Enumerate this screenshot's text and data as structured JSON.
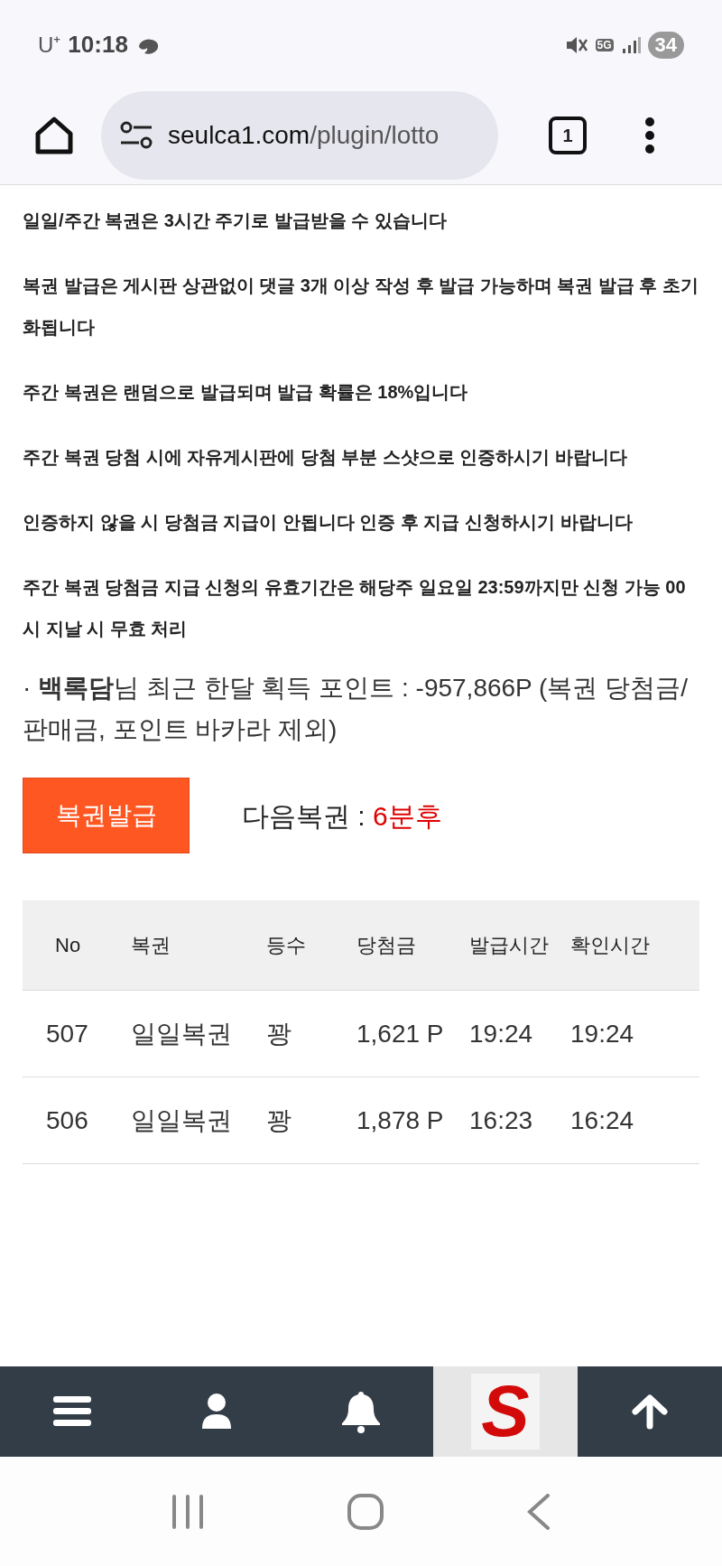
{
  "status_bar": {
    "carrier": "U⁺",
    "time": "10:18",
    "network": "5G",
    "battery": "34"
  },
  "browser": {
    "url_host": "seulca1.com",
    "url_path": "/plugin/lotto",
    "tab_count": "1"
  },
  "notices": [
    "일일/주간 복권은 3시간 주기로 발급받을 수 있습니다",
    "복권 발급은 게시판 상관없이 댓글 3개 이상 작성 후 발급 가능하며 복권 발급 후 초기화됩니다",
    "주간 복권은 랜덤으로 발급되며 발급 확률은 18%입니다",
    "주간 복권 당첨 시에 자유게시판에 당첨 부분 스샷으로 인증하시기 바랍니다",
    "인증하지 않을 시 당첨금 지급이 안됩니다 인증 후 지급 신청하시기 바랍니다",
    "주간 복권 당첨금 지급 신청의 유효기간은 해당주 일요일 23:59까지만 신청 가능 00시 지날 시 무효 처리"
  ],
  "points_line": "· **백록담**님 최근 한달 획득 포인트 : -957,866P (복권 당첨금/판매금, 포인트 바카라 제외)",
  "issue_button": "복권발급",
  "next_label": "다음복권 : ",
  "next_value": "6분후",
  "table": {
    "columns": [
      "No",
      "복권",
      "등수",
      "당첨금",
      "발급시간",
      "확인시간"
    ],
    "rows": [
      [
        "507",
        "일일복권",
        "꽝",
        "1,621 P",
        "19:24",
        "19:24"
      ],
      [
        "506",
        "일일복권",
        "꽝",
        "1,878 P",
        "16:23",
        "16:24"
      ]
    ]
  },
  "bottom_nav": {
    "logo": "S"
  }
}
